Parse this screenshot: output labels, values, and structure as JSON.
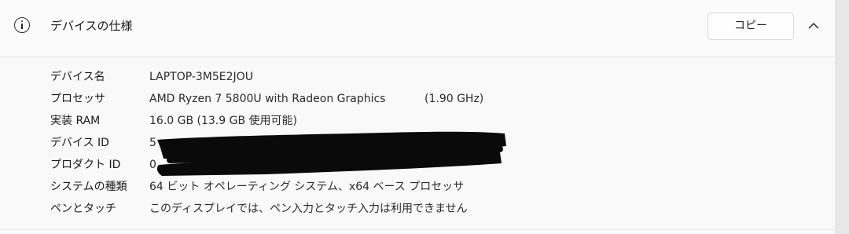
{
  "header": {
    "title": "デバイスの仕様",
    "copy_label": "コピー",
    "info_icon": "info-icon",
    "collapse_icon": "chevron-up-icon"
  },
  "specs": [
    {
      "label": "デバイス名",
      "value": "LAPTOP-3M5E2JOU"
    },
    {
      "label": "プロセッサ",
      "value": "AMD Ryzen 7 5800U with Radeon Graphics",
      "extra": "(1.90 GHz)"
    },
    {
      "label": "実装 RAM",
      "value": "16.0 GB (13.9 GB 使用可能)"
    },
    {
      "label": "デバイス ID",
      "value": "5"
    },
    {
      "label": "プロダクト ID",
      "value": "0"
    },
    {
      "label": "システムの種類",
      "value": "64 ビット オペレーティング システム、x64 ベース プロセッサ"
    },
    {
      "label": "ペンとタッチ",
      "value": "このディスプレイでは、ペン入力とタッチ入力は利用できません"
    }
  ]
}
